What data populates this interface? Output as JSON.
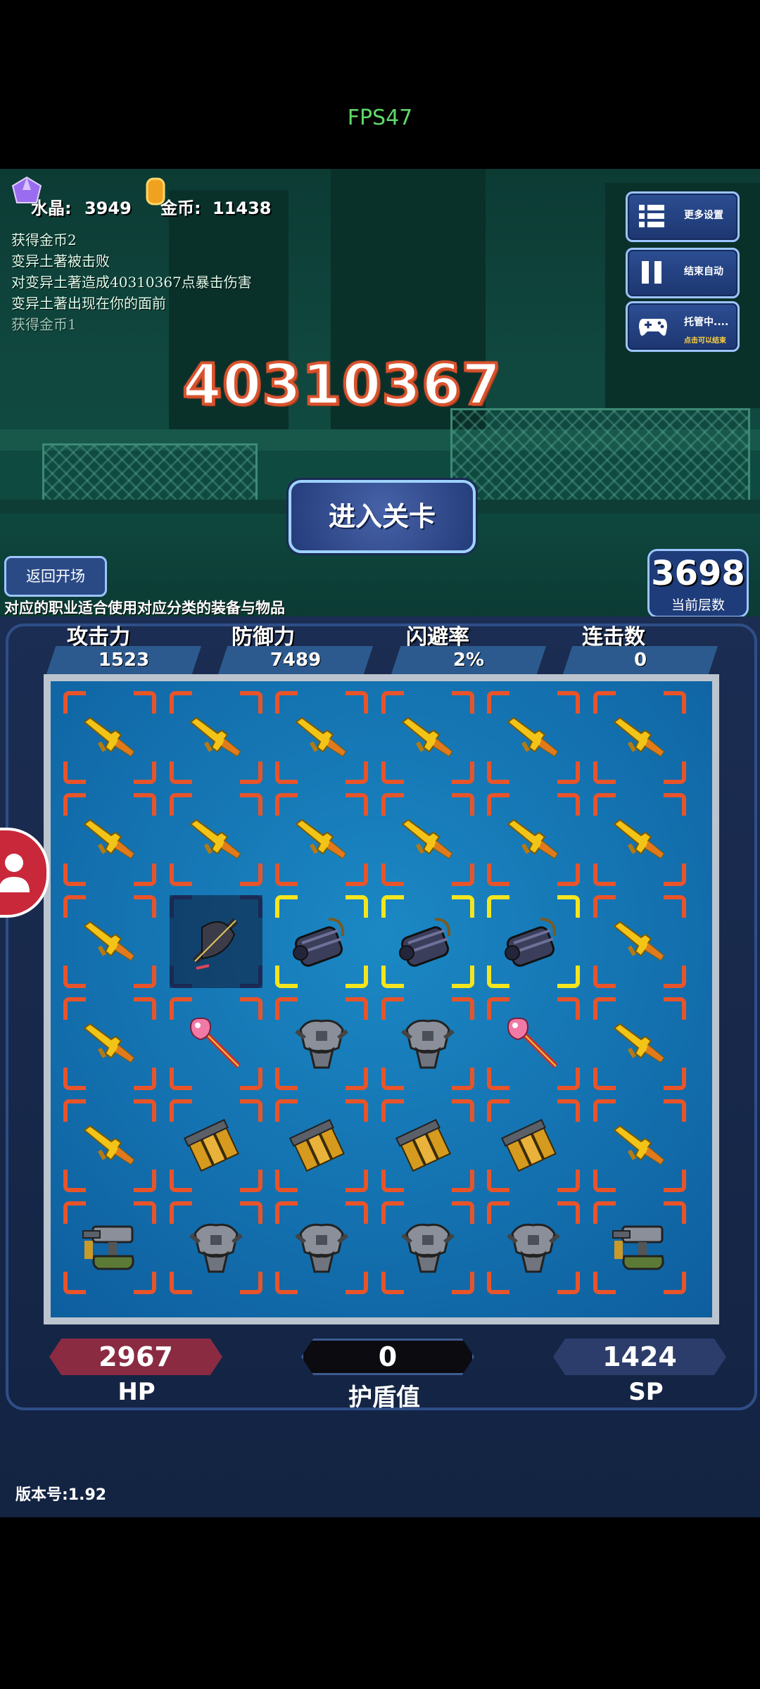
{
  "fps": "FPS47",
  "resources": {
    "crystal_label": "水晶:",
    "crystal_value": "3949",
    "gold_label": "金币:",
    "gold_value": "11438"
  },
  "battle_log": [
    "获得金币2",
    "变异土著被击败",
    "对变异土著造成40310367点暴击伤害",
    "变异土著出现在你的面前",
    "获得金币1"
  ],
  "side_buttons": {
    "more_settings": "更多设置",
    "end_auto": "结束自动",
    "managed": "托管中....",
    "managed_sub": "点击可以结束"
  },
  "damage_number": "40310367",
  "enter_level_button": "进入关卡",
  "back_button": "返回开场",
  "floor": {
    "value": "3698",
    "label": "当前层数"
  },
  "tip": "对应的职业适合使用对应分类的装备与物品",
  "stats": [
    {
      "label": "攻击力",
      "value": "1523"
    },
    {
      "label": "防御力",
      "value": "7489"
    },
    {
      "label": "闪避率",
      "value": "2%"
    },
    {
      "label": "连击数",
      "value": "0"
    }
  ],
  "colors": {
    "frame_red": "#e8542a",
    "frame_yellow": "#f4e51f",
    "frame_dark": "#1a2a55",
    "hp_bar": "#8a2b42",
    "shield_bar": "#0b0b10",
    "sp_bar": "#2c3d6c"
  },
  "inventory": [
    [
      "rifle-icon",
      "rifle-icon",
      "rifle-icon",
      "rifle-icon",
      "rifle-icon",
      "rifle-icon"
    ],
    [
      "rifle-icon",
      "rifle-icon",
      "rifle-icon",
      "rifle-icon",
      "rifle-icon",
      "rifle-icon"
    ],
    [
      "rifle-icon",
      "crossbow-icon",
      "gatling-icon",
      "gatling-icon",
      "gatling-icon",
      "rifle-icon"
    ],
    [
      "rifle-icon",
      "wand-icon",
      "armor-icon",
      "armor-icon",
      "wand-icon",
      "rifle-icon"
    ],
    [
      "rifle-icon",
      "ammo-icon",
      "ammo-icon",
      "ammo-icon",
      "ammo-icon",
      "rifle-icon"
    ],
    [
      "turret-icon",
      "armor-icon",
      "armor-icon",
      "armor-icon",
      "armor-icon",
      "turret-icon"
    ]
  ],
  "inventory_frames": [
    [
      "red",
      "red",
      "red",
      "red",
      "red",
      "red"
    ],
    [
      "red",
      "red",
      "red",
      "red",
      "red",
      "red"
    ],
    [
      "red",
      "dark",
      "yellow",
      "yellow",
      "yellow",
      "red"
    ],
    [
      "red",
      "red",
      "red",
      "red",
      "red",
      "red"
    ],
    [
      "red",
      "red",
      "red",
      "red",
      "red",
      "red"
    ],
    [
      "red",
      "red",
      "red",
      "red",
      "red",
      "red"
    ]
  ],
  "bottom_stats": {
    "hp_value": "2967",
    "hp_label": "HP",
    "shield_value": "0",
    "shield_label": "护盾值",
    "sp_value": "1424",
    "sp_label": "SP"
  },
  "version": "版本号:1.92"
}
